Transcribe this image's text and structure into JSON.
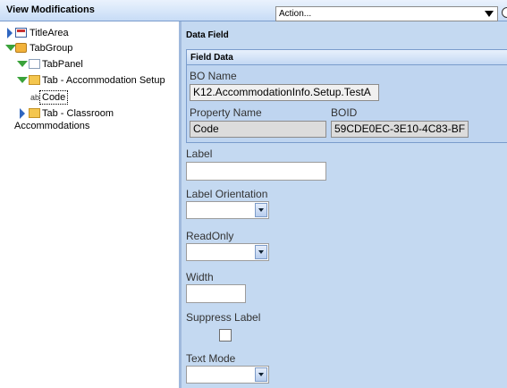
{
  "header": {
    "title": "View Modifications",
    "action_select_value": "Action..."
  },
  "tree": {
    "nodes": [
      {
        "label": "TitleArea"
      },
      {
        "label": "TabGroup"
      },
      {
        "label": "TabPanel"
      },
      {
        "label": "Tab - Accommodation Setup"
      },
      {
        "label": "Code"
      },
      {
        "label": "Tab - Classroom"
      },
      {
        "label": "Accommodations"
      }
    ]
  },
  "panel": {
    "section_title": "Data Field",
    "field_data": {
      "header": "Field Data",
      "bo_name_label": "BO Name",
      "bo_name_value": "K12.AccommodationInfo.Setup.TestA",
      "property_name_label": "Property Name",
      "property_name_value": "Code",
      "boid_label": "BOID",
      "boid_value": "59CDE0EC-3E10-4C83-BF"
    },
    "label_label": "Label",
    "label_value": "",
    "label_orientation_label": "Label Orientation",
    "readonly_label": "ReadOnly",
    "width_label": "Width",
    "width_value": "",
    "suppress_label_label": "Suppress Label",
    "text_mode_label": "Text Mode"
  },
  "icons": {
    "expand": "expand-arrow-icon",
    "collapse": "collapse-arrow-icon",
    "folder": "folder-icon",
    "panel": "panel-icon",
    "textbox": "textbox-icon"
  }
}
